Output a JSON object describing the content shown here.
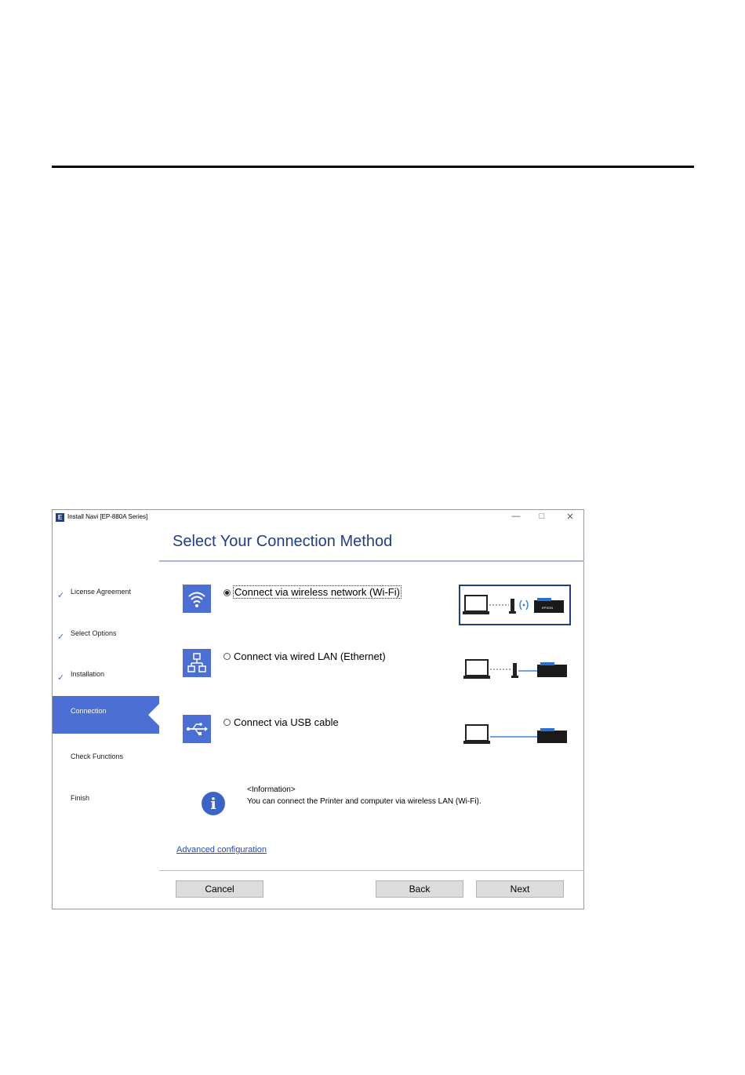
{
  "window": {
    "title": "Install Navi [EP-880A Series]",
    "controls": {
      "minimize": "—",
      "maximize": "□",
      "close": "✕"
    }
  },
  "sidebar": {
    "steps": [
      {
        "label": "License Agreement",
        "state": "done"
      },
      {
        "label": "Select Options",
        "state": "done"
      },
      {
        "label": "Installation",
        "state": "done"
      },
      {
        "label": "Connection",
        "state": "active"
      },
      {
        "label": "Check Functions",
        "state": "pending"
      },
      {
        "label": "Finish",
        "state": "pending"
      }
    ]
  },
  "main": {
    "heading": "Select Your Connection Method",
    "options": [
      {
        "label": "Connect via wireless network (Wi-Fi)",
        "selected": true,
        "icon": "wifi-icon"
      },
      {
        "label": "Connect via wired LAN (Ethernet)",
        "selected": false,
        "icon": "network-icon"
      },
      {
        "label": "Connect via USB cable",
        "selected": false,
        "icon": "usb-icon"
      }
    ],
    "printer_brand": "EPSON",
    "info": {
      "title": "<Information>",
      "text": "You can connect the Printer and computer via wireless LAN (Wi-Fi)."
    },
    "advanced_link": "Advanced configuration"
  },
  "buttons": {
    "cancel": "Cancel",
    "back": "Back",
    "next": "Next"
  },
  "colors": {
    "accent": "#4b6fd4",
    "heading": "#1f3e8a",
    "link": "#2348c8"
  }
}
